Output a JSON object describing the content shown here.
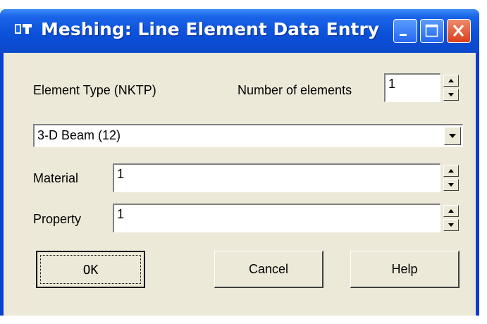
{
  "window": {
    "title": "Meshing: Line Element Data Entry"
  },
  "title_buttons": [
    "minimize",
    "maximize",
    "close"
  ],
  "labels": {
    "element_type": "Element Type (NKTP)",
    "number_of_elements": "Number of elements",
    "material": "Material",
    "property": "Property"
  },
  "fields": {
    "number_of_elements": "1",
    "element_type": "3-D Beam (12)",
    "material": "1",
    "property": "1"
  },
  "buttons": {
    "ok": "OK",
    "cancel": "Cancel",
    "help": "Help"
  },
  "colors": {
    "titlebar": "#0b50d8",
    "dialog_face": "#ece9d8",
    "close_button": "#d8401c"
  }
}
